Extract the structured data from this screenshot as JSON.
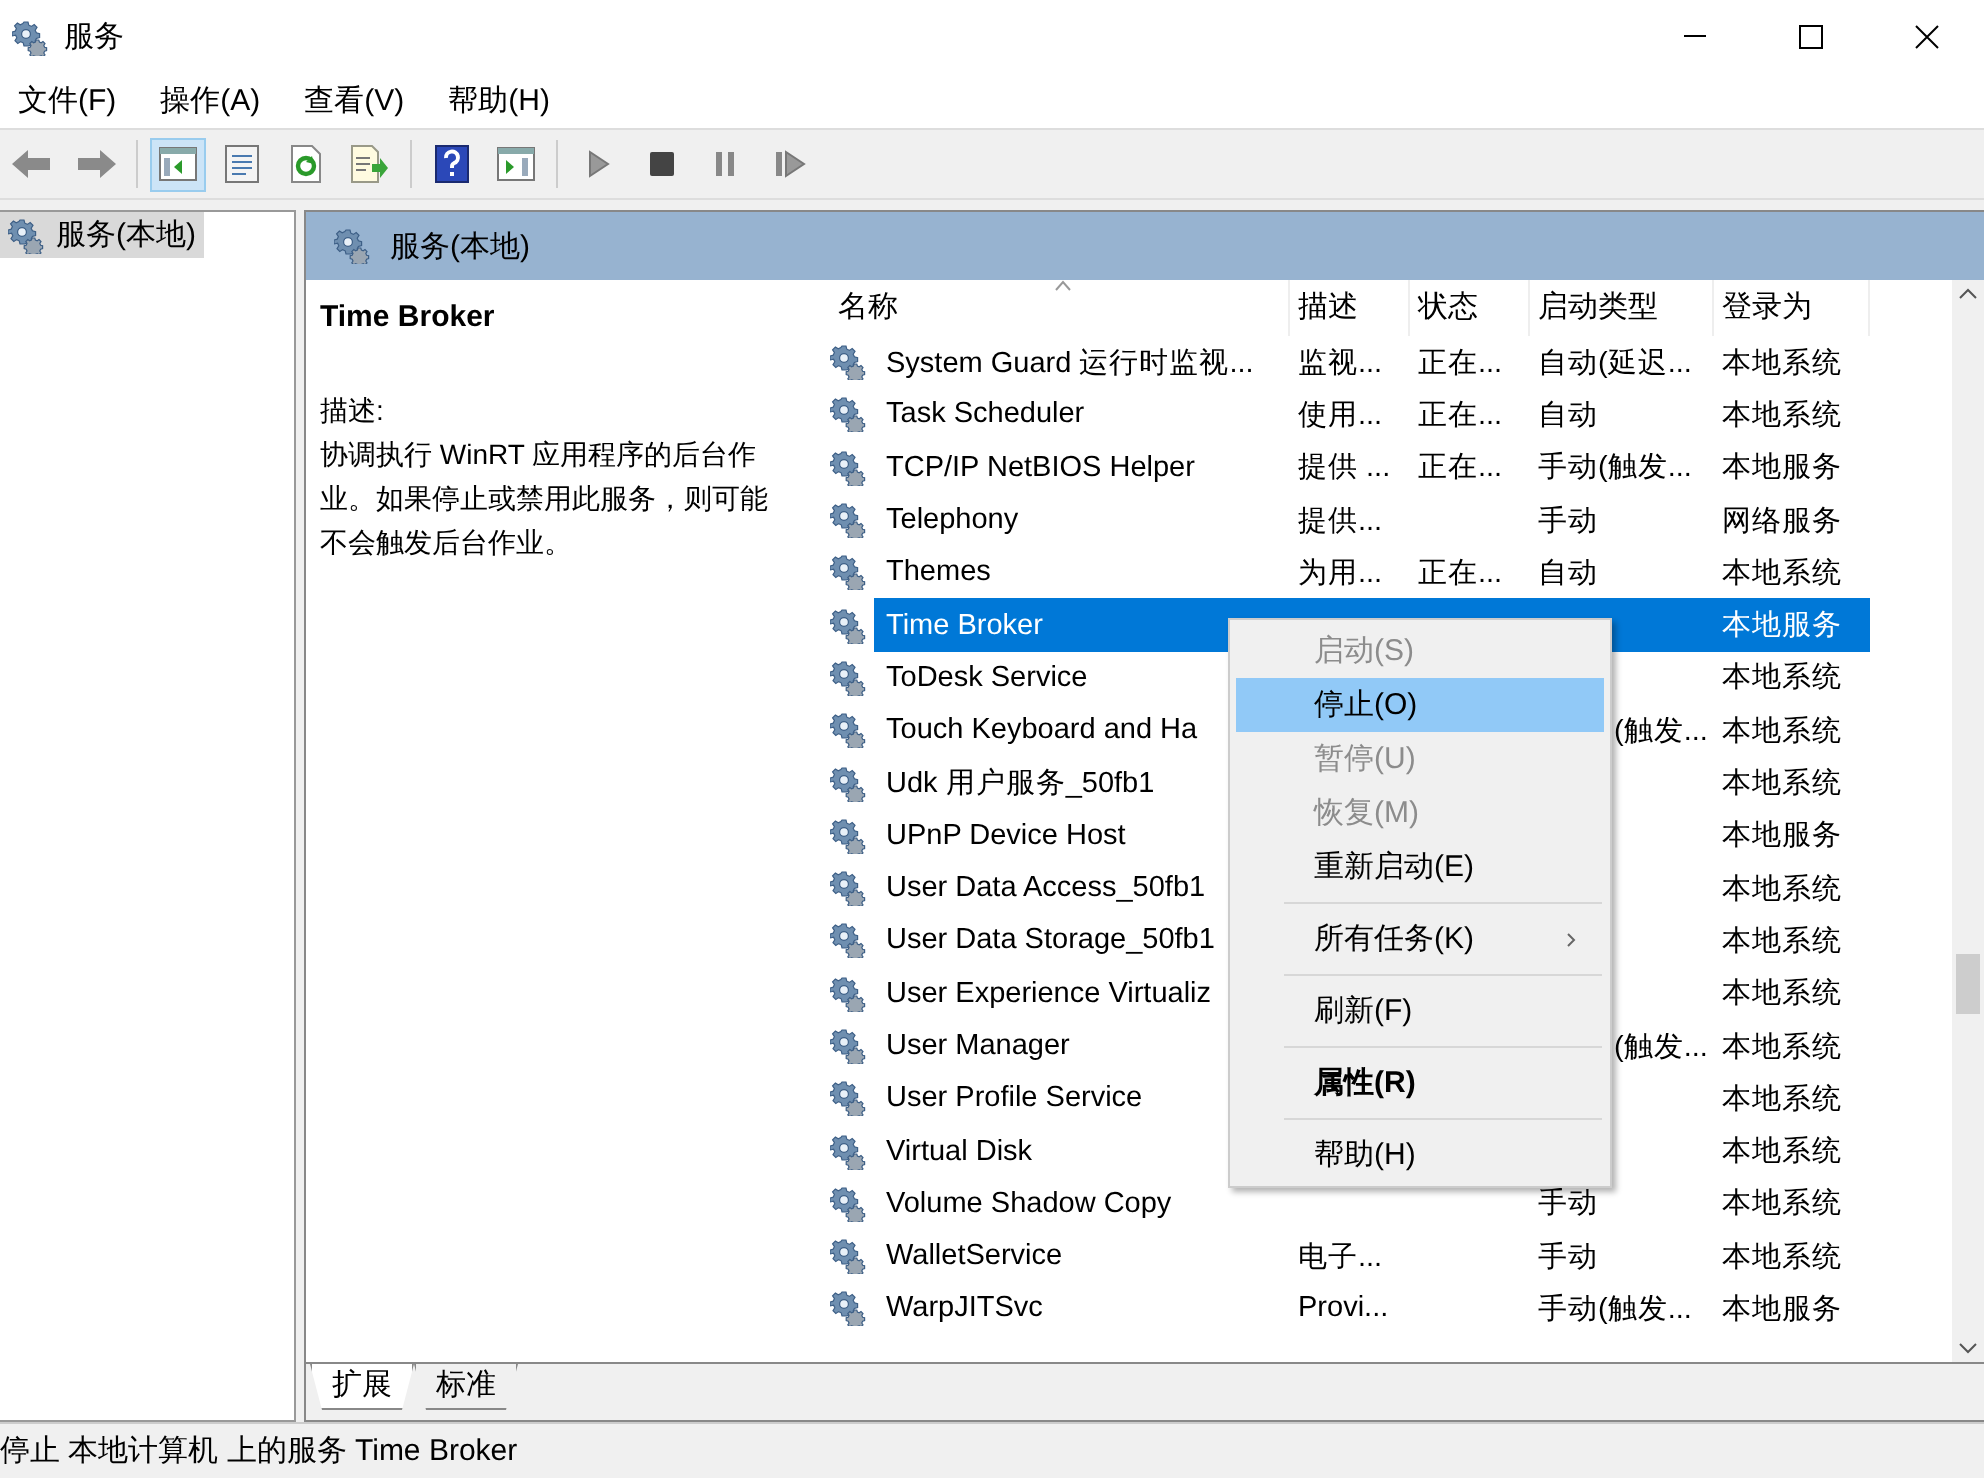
{
  "window": {
    "title": "服务"
  },
  "menubar": [
    "文件(F)",
    "操作(A)",
    "查看(V)",
    "帮助(H)"
  ],
  "toolbar": [
    {
      "kind": "back",
      "pressed": false
    },
    {
      "kind": "forward",
      "pressed": false
    },
    {
      "kind": "separator"
    },
    {
      "kind": "tree",
      "pressed": true
    },
    {
      "kind": "properties",
      "pressed": false
    },
    {
      "kind": "refresh",
      "pressed": false
    },
    {
      "kind": "export",
      "pressed": false
    },
    {
      "kind": "separator"
    },
    {
      "kind": "help",
      "pressed": false
    },
    {
      "kind": "pane",
      "pressed": false
    },
    {
      "kind": "separator"
    },
    {
      "kind": "play",
      "pressed": false
    },
    {
      "kind": "stop",
      "pressed": false
    },
    {
      "kind": "pause",
      "pressed": false
    },
    {
      "kind": "resume",
      "pressed": false
    }
  ],
  "tree": {
    "items": [
      {
        "label": "服务(本地)",
        "selected": true
      }
    ]
  },
  "panel": {
    "title": "服务(本地)"
  },
  "details": {
    "service": "Time Broker",
    "description_label": "描述:",
    "description": "协调执行 WinRT 应用程序的后台作业。如果停止或禁用此服务，则可能不会触发后台作业。"
  },
  "table": {
    "columns": [
      "名称",
      "描述",
      "状态",
      "启动类型",
      "登录为"
    ],
    "rows": [
      {
        "name": "System Guard 运行时监视...",
        "description": "监视...",
        "status": "正在...",
        "startup": "自动(延迟...",
        "logon": "本地系统",
        "selected": false
      },
      {
        "name": "Task Scheduler",
        "description": "使用...",
        "status": "正在...",
        "startup": "自动",
        "logon": "本地系统",
        "selected": false
      },
      {
        "name": "TCP/IP NetBIOS Helper",
        "description": "提供 ...",
        "status": "正在...",
        "startup": "手动(触发...",
        "logon": "本地服务",
        "selected": false
      },
      {
        "name": "Telephony",
        "description": "提供...",
        "startup": "手动",
        "logon": "网络服务",
        "selected": false
      },
      {
        "name": "Themes",
        "description": "为用...",
        "status": "正在...",
        "startup": "自动",
        "logon": "本地系统",
        "selected": false
      },
      {
        "name": "Time Broker",
        "logon": "本地服务",
        "selected": true
      },
      {
        "name": "ToDesk Service",
        "logon": "本地系统",
        "selected": false
      },
      {
        "name": "Touch Keyboard and Ha",
        "startup_partial": "(触发...",
        "logon": "本地系统",
        "selected": false
      },
      {
        "name": "Udk 用户服务_50fb1",
        "logon": "本地系统",
        "selected": false
      },
      {
        "name": "UPnP Device Host",
        "logon": "本地服务",
        "selected": false
      },
      {
        "name": "User Data Access_50fb1",
        "logon": "本地系统",
        "selected": false
      },
      {
        "name": "User Data Storage_50fb1",
        "logon": "本地系统",
        "selected": false
      },
      {
        "name": "User Experience Virtualiz",
        "logon": "本地系统",
        "selected": false
      },
      {
        "name": "User Manager",
        "startup_partial": "(触发...",
        "logon": "本地系统",
        "selected": false
      },
      {
        "name": "User Profile Service",
        "logon": "本地系统",
        "selected": false
      },
      {
        "name": "Virtual Disk",
        "logon": "本地系统",
        "selected": false
      },
      {
        "name": "Volume Shadow Copy",
        "startup": "手动",
        "logon": "本地系统",
        "selected": false
      },
      {
        "name": "WalletService",
        "description": "电子...",
        "startup": "手动",
        "logon": "本地系统",
        "selected": false
      },
      {
        "name": "WarpJITSvc",
        "description": "Provi...",
        "startup": "手动(触发...",
        "logon": "本地服务",
        "selected": false
      }
    ]
  },
  "context_menu": [
    {
      "kind": "item",
      "label": "启动(S)",
      "disabled": true,
      "selected": false,
      "default": false,
      "submenu": false
    },
    {
      "kind": "item",
      "label": "停止(O)",
      "disabled": false,
      "selected": true,
      "default": false,
      "submenu": false
    },
    {
      "kind": "item",
      "label": "暂停(U)",
      "disabled": true,
      "selected": false,
      "default": false,
      "submenu": false
    },
    {
      "kind": "item",
      "label": "恢复(M)",
      "disabled": true,
      "selected": false,
      "default": false,
      "submenu": false
    },
    {
      "kind": "item",
      "label": "重新启动(E)",
      "disabled": false,
      "selected": false,
      "default": false,
      "submenu": false
    },
    {
      "kind": "separator"
    },
    {
      "kind": "item",
      "label": "所有任务(K)",
      "disabled": false,
      "selected": false,
      "default": false,
      "submenu": true
    },
    {
      "kind": "separator"
    },
    {
      "kind": "item",
      "label": "刷新(F)",
      "disabled": false,
      "selected": false,
      "default": false,
      "submenu": false
    },
    {
      "kind": "separator"
    },
    {
      "kind": "item",
      "label": "属性(R)",
      "disabled": false,
      "selected": false,
      "default": true,
      "submenu": false
    },
    {
      "kind": "separator"
    },
    {
      "kind": "item",
      "label": "帮助(H)",
      "disabled": false,
      "selected": false,
      "default": false,
      "submenu": false
    }
  ],
  "view_tabs": [
    {
      "label": "扩展",
      "selected": true
    },
    {
      "label": "标准",
      "selected": false
    }
  ],
  "status_bar": "停止 本地计算机 上的服务 Time Broker"
}
